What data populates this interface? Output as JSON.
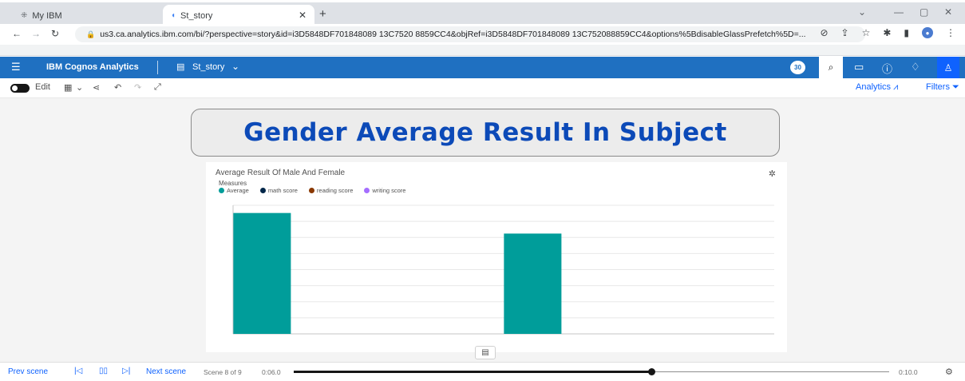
{
  "browser": {
    "tabs": [
      {
        "title": "My IBM",
        "icon": "ibm-icon",
        "active": false
      },
      {
        "title": "St_story",
        "icon": "cognos-icon",
        "active": true
      }
    ],
    "new_tab": "+",
    "url": "us3.ca.analytics.ibm.com/bi/?perspective=story&id=i3D5848DF701848089 13C7520 8859CC4&objRef=i3D5848DF701848089 13C752088859CC4&options%5BdisableGlassPrefetch%5D=..."
  },
  "app": {
    "brand": "IBM Cognos Analytics",
    "story_name": "St_story",
    "notification_count": "30"
  },
  "toolbar": {
    "edit_label": "Edit",
    "analytics_label": "Analytics",
    "filters_label": "Filters"
  },
  "scene": {
    "title": "Gender Average Result In Subject",
    "chart_title": "Average Result Of Male And Female",
    "measures_label": "Measures",
    "legend": [
      {
        "label": "Average",
        "color": "#009d9a"
      },
      {
        "label": "math score",
        "color": "#012749"
      },
      {
        "label": "reading score",
        "color": "#8a3800"
      },
      {
        "label": "writing score",
        "color": "#a56eff"
      }
    ]
  },
  "chart_data": {
    "type": "bar",
    "title": "Average Result Of Male And Female",
    "legend_title": "Measures",
    "series": [
      {
        "name": "Average",
        "values": [
          94,
          0,
          0,
          0,
          78,
          0,
          0,
          0
        ]
      },
      {
        "name": "math score",
        "values": []
      },
      {
        "name": "reading score",
        "values": []
      },
      {
        "name": "writing score",
        "values": []
      }
    ],
    "ylim": [
      0,
      100
    ],
    "grid": true,
    "legend_position": "top-left"
  },
  "playback": {
    "prev_label": "Prev scene",
    "next_label": "Next scene",
    "scene_counter": "Scene 8 of 9",
    "current_time": "0:06.0",
    "end_time": "0:10.0",
    "progress": 0.6
  }
}
